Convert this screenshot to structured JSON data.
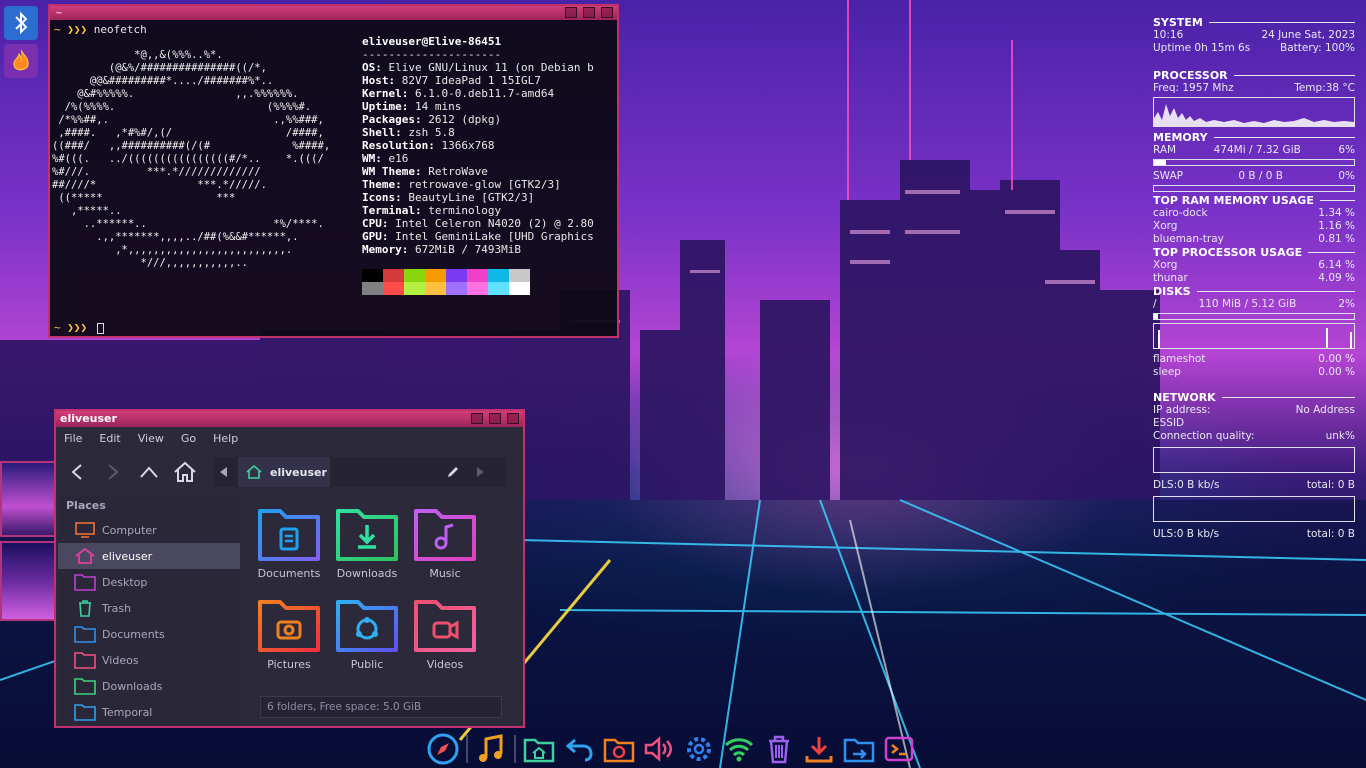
{
  "terminal": {
    "title": "~",
    "command": "neofetch",
    "prompt": "~ ❯❯❯",
    "ascii": [
      "             *@,,&(%%%..%*.",
      "         (@&%/###############((/*,",
      "      @@&#########*..../#######%*..",
      "    @&#%%%%%.                ,,.%%%%%%.",
      "  /%(%%%%.                        (%%%%#.",
      " /*%%##,.                          .,%%###,",
      " ,####.   ,*#%#/,(/                  /####,",
      "((###/   ,,##########(/(#             %####,",
      "%#(((.   ../((((((((((((((((#/*..    *.(((/",
      "%#///.         ***.*/////////////",
      "##////*                ***.*/////.",
      " ((*****                  ***",
      "   ,*****..",
      "     ..******..                    *%/****.",
      "       .,,*******,,,,../##(%&&#******,.",
      "          ,*,,,,,,,,,,,,,,,,,,,,,,,,,.",
      "              *///,,,,,,,,,,,.."
    ],
    "user_host": "eliveuser@Elive-86451",
    "separator": "---------------------",
    "info": [
      {
        "key": "OS",
        "value": " Elive GNU/Linux 11 (on Debian b"
      },
      {
        "key": "Host",
        "value": " 82V7 IdeaPad 1 15IGL7"
      },
      {
        "key": "Kernel",
        "value": " 6.1.0-0.deb11.7-amd64"
      },
      {
        "key": "Uptime",
        "value": " 14 mins"
      },
      {
        "key": "Packages",
        "value": " 2612 (dpkg)"
      },
      {
        "key": "Shell",
        "value": " zsh 5.8"
      },
      {
        "key": "Resolution",
        "value": " 1366x768"
      },
      {
        "key": "WM",
        "value": " e16"
      },
      {
        "key": "WM Theme",
        "value": " RetroWave"
      },
      {
        "key": "Theme",
        "value": " retrowave-glow [GTK2/3]"
      },
      {
        "key": "Icons",
        "value": " BeautyLine [GTK2/3]"
      },
      {
        "key": "Terminal",
        "value": " terminology"
      },
      {
        "key": "CPU",
        "value": " Intel Celeron N4020 (2) @ 2.80"
      },
      {
        "key": "GPU",
        "value": " Intel GeminiLake [UHD Graphics"
      },
      {
        "key": "Memory",
        "value": " 672MiB / 7493MiB"
      }
    ],
    "palette_top": [
      "#000000",
      "#d43a3a",
      "#8ad410",
      "#f59a00",
      "#7a3cf0",
      "#f040c8",
      "#10b8e8",
      "#c8c8c8"
    ],
    "palette_bottom": [
      "#808080",
      "#ff4a4a",
      "#b4f040",
      "#ffc040",
      "#a070ff",
      "#ff70e0",
      "#60e0ff",
      "#ffffff"
    ]
  },
  "filemanager": {
    "title": "eliveuser",
    "menu": [
      "File",
      "Edit",
      "View",
      "Go",
      "Help"
    ],
    "path_crumb": "eliveuser",
    "places_title": "Places",
    "places": [
      {
        "label": "Computer",
        "icon": "computer-icon",
        "color": "#f07030"
      },
      {
        "label": "eliveuser",
        "icon": "home-icon",
        "color": "#e040a0"
      },
      {
        "label": "Desktop",
        "icon": "desktop-folder-icon",
        "color": "#c040d0"
      },
      {
        "label": "Trash",
        "icon": "trash-icon",
        "color": "#40d0a0"
      },
      {
        "label": "Documents",
        "icon": "documents-folder-icon",
        "color": "#3090f0"
      },
      {
        "label": "Videos",
        "icon": "videos-folder-icon",
        "color": "#f05080"
      },
      {
        "label": "Downloads",
        "icon": "downloads-folder-icon",
        "color": "#40d080"
      },
      {
        "label": "Temporal",
        "icon": "folder-icon",
        "color": "#30a0f0"
      }
    ],
    "items": [
      {
        "label": "Documents",
        "icon": "documents-folder-icon",
        "c1": "#20a0f0",
        "c2": "#8060f0"
      },
      {
        "label": "Downloads",
        "icon": "downloads-folder-icon",
        "c1": "#30e0a0",
        "c2": "#30c060"
      },
      {
        "label": "Music",
        "icon": "music-folder-icon",
        "c1": "#c060f0",
        "c2": "#e040c0"
      },
      {
        "label": "Pictures",
        "icon": "pictures-folder-icon",
        "c1": "#f08020",
        "c2": "#f03040"
      },
      {
        "label": "Public",
        "icon": "public-folder-icon",
        "c1": "#30b0f0",
        "c2": "#6050f0"
      },
      {
        "label": "Videos",
        "icon": "videos-folder-icon",
        "c1": "#f05070",
        "c2": "#f060a0"
      }
    ],
    "status": "6 folders, Free space: 5.0 GiB"
  },
  "conky": {
    "system_title": "SYSTEM",
    "time": "10:16",
    "date": "24 June Sat, 2023",
    "uptime": "Uptime 0h 15m 6s",
    "battery": "Battery: 100%",
    "processor_title": "PROCESSOR",
    "freq": "Freq: 1957 Mhz",
    "temp": "Temp:38 °C",
    "memory_title": "MEMORY",
    "ram_label": "RAM",
    "ram_value": "474Mi / 7.32 GiB",
    "ram_pct": "6%",
    "ram_fill": 0.06,
    "swap_label": "SWAP",
    "swap_value": "0 B / 0 B",
    "swap_pct": "0%",
    "top_ram_title": "TOP RAM MEMORY USAGE",
    "top_ram": [
      {
        "name": "cairo-dock",
        "value": "1.34 %"
      },
      {
        "name": "Xorg",
        "value": "1.16 %"
      },
      {
        "name": "blueman-tray",
        "value": "0.81 %"
      }
    ],
    "top_cpu_title": "TOP PROCESSOR USAGE",
    "top_cpu": [
      {
        "name": "Xorg",
        "value": "6.14 %"
      },
      {
        "name": "thunar",
        "value": "4.09 %"
      }
    ],
    "disks_title": "DISKS",
    "disk_mount": "/",
    "disk_value": "110 MiB / 5.12 GiB",
    "disk_pct": "2%",
    "disk_fill": 0.02,
    "io_procs": [
      {
        "name": "flameshot",
        "value": "0.00 %"
      },
      {
        "name": "sleep",
        "value": "0.00 %"
      }
    ],
    "network_title": "NETWORK",
    "ip_label": "IP address:",
    "ip_value": "No Address",
    "essid_label": "ESSID",
    "quality_label": "Connection quality:",
    "quality_value": "unk%",
    "dls": "DLS:0 B kb/s",
    "dls_total": "total: 0 B",
    "uls": "ULS:0 B kb/s",
    "uls_total": "total: 0 B"
  },
  "dock": [
    "safari-icon",
    "music-icon",
    "home-folder-icon",
    "undo-icon",
    "camera-icon",
    "volume-icon",
    "settings-icon",
    "wifi-icon",
    "trash-icon",
    "download-icon",
    "folder-share-icon",
    "terminal-icon"
  ],
  "left_dock": [
    "bluetooth-icon",
    "flame-icon"
  ]
}
